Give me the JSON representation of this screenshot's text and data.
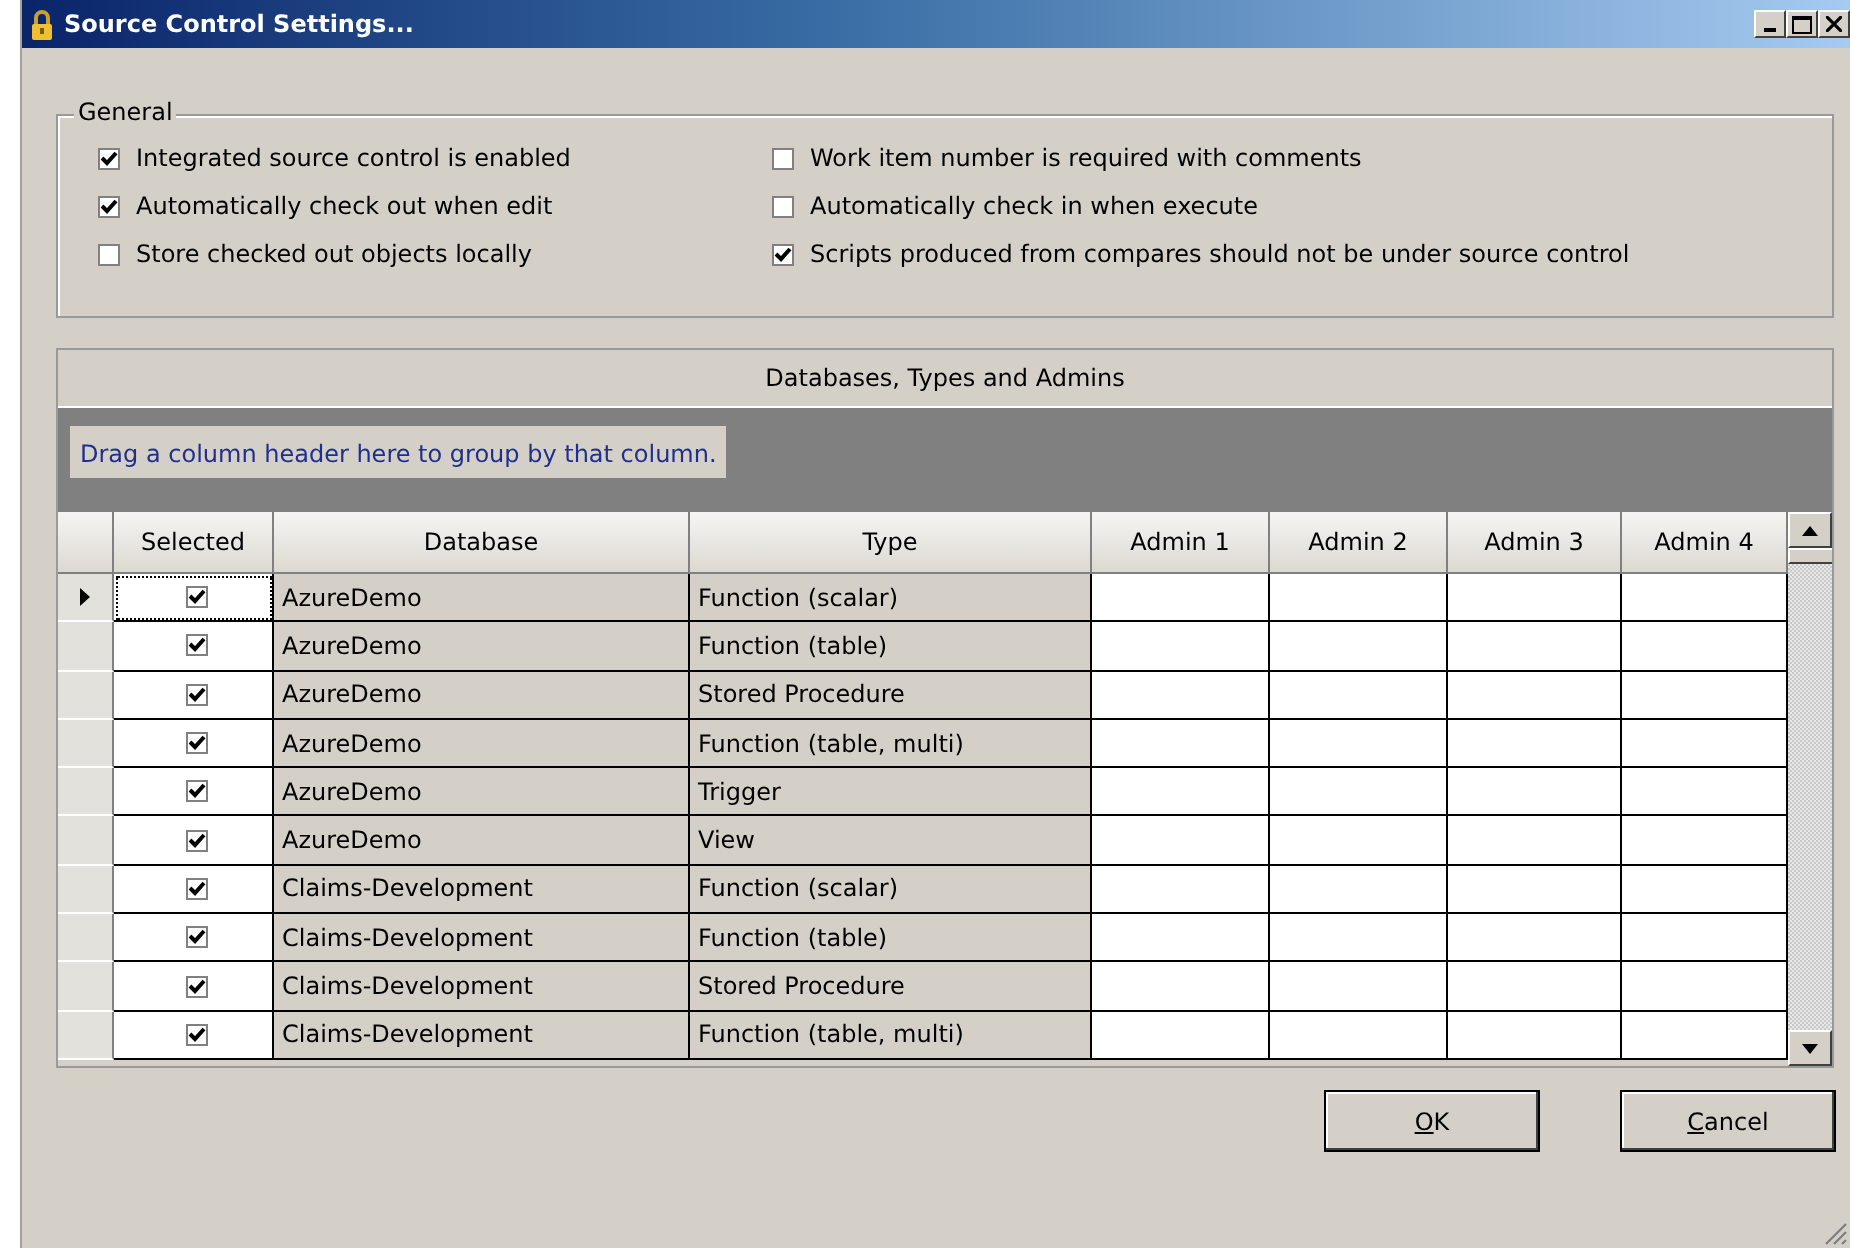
{
  "window": {
    "title": "Source Control Settings..."
  },
  "general": {
    "title": "General",
    "options": [
      {
        "label": "Integrated source control is enabled",
        "checked": true
      },
      {
        "label": "Work item number is required with comments",
        "checked": false
      },
      {
        "label": "Automatically check out when edit",
        "checked": true
      },
      {
        "label": "Automatically check in when execute",
        "checked": false
      },
      {
        "label": "Store checked out objects locally",
        "checked": false
      },
      {
        "label": "Scripts produced from compares should not be under source control",
        "checked": true
      }
    ]
  },
  "grid": {
    "title": "Databases, Types and Admins",
    "group_hint": "Drag a column header here to group by that column.",
    "columns": [
      "Selected",
      "Database",
      "Type",
      "Admin 1",
      "Admin 2",
      "Admin 3",
      "Admin 4"
    ],
    "rows": [
      {
        "current": true,
        "checked": true,
        "database": "AzureDemo",
        "type": "Function (scalar)"
      },
      {
        "current": false,
        "checked": true,
        "database": "AzureDemo",
        "type": "Function (table)"
      },
      {
        "current": false,
        "checked": true,
        "database": "AzureDemo",
        "type": "Stored Procedure"
      },
      {
        "current": false,
        "checked": true,
        "database": "AzureDemo",
        "type": "Function (table, multi)"
      },
      {
        "current": false,
        "checked": true,
        "database": "AzureDemo",
        "type": "Trigger"
      },
      {
        "current": false,
        "checked": true,
        "database": "AzureDemo",
        "type": "View"
      },
      {
        "current": false,
        "checked": true,
        "database": "Claims-Development",
        "type": "Function (scalar)"
      },
      {
        "current": false,
        "checked": true,
        "database": "Claims-Development",
        "type": "Function (table)"
      },
      {
        "current": false,
        "checked": true,
        "database": "Claims-Development",
        "type": "Stored Procedure"
      },
      {
        "current": false,
        "checked": true,
        "database": "Claims-Development",
        "type": "Function (table, multi)"
      }
    ]
  },
  "buttons": [
    "OK",
    "Cancel"
  ]
}
